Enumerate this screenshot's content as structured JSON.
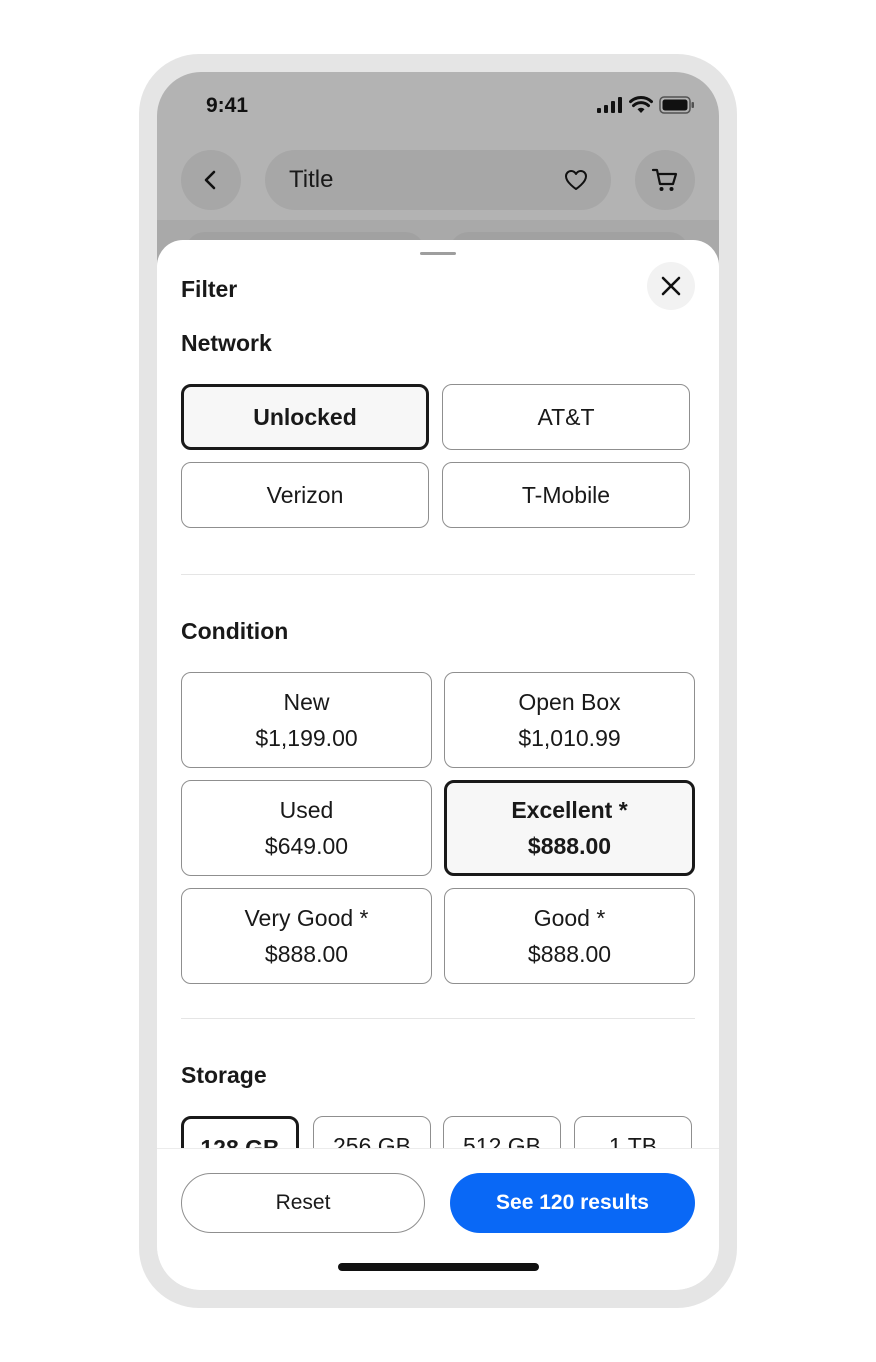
{
  "status_bar": {
    "time": "9:41"
  },
  "header": {
    "title": "Title"
  },
  "sheet": {
    "title": "Filter",
    "network": {
      "heading": "Network",
      "options": [
        {
          "label": "Unlocked",
          "selected": true
        },
        {
          "label": "AT&T",
          "selected": false
        },
        {
          "label": "Verizon",
          "selected": false
        },
        {
          "label": "T-Mobile",
          "selected": false
        }
      ]
    },
    "condition": {
      "heading": "Condition",
      "options": [
        {
          "label": "New",
          "price": "$1,199.00",
          "selected": false
        },
        {
          "label": "Open Box",
          "price": "$1,010.99",
          "selected": false
        },
        {
          "label": "Used",
          "price": "$649.00",
          "selected": false
        },
        {
          "label": "Excellent *",
          "price": "$888.00",
          "selected": true
        },
        {
          "label": "Very Good *",
          "price": "$888.00",
          "selected": false
        },
        {
          "label": "Good *",
          "price": "$888.00",
          "selected": false
        }
      ]
    },
    "storage": {
      "heading": "Storage",
      "options": [
        {
          "label": "128 GB",
          "selected": true
        },
        {
          "label": "256 GB",
          "selected": false
        },
        {
          "label": "512 GB",
          "selected": false
        },
        {
          "label": "1 TB",
          "selected": false
        }
      ]
    }
  },
  "footer": {
    "reset_label": "Reset",
    "results_label": "See 120 results"
  },
  "colors": {
    "primary": "#0968f6",
    "selected_border": "#191919",
    "border": "#8f8f8f"
  }
}
